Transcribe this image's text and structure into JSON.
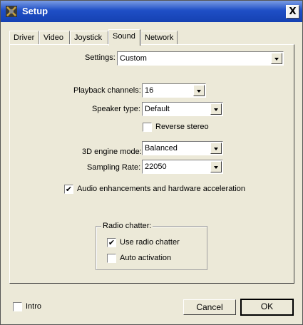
{
  "window": {
    "title": "Setup",
    "close_label": "X"
  },
  "tabs": [
    {
      "label": "Driver"
    },
    {
      "label": "Video"
    },
    {
      "label": "Joystick"
    },
    {
      "label": "Sound",
      "active": true
    },
    {
      "label": "Network"
    }
  ],
  "sound": {
    "settings_label": "Settings:",
    "settings_value": "Custom",
    "playback_channels_label": "Playback channels:",
    "playback_channels_value": "16",
    "speaker_type_label": "Speaker type:",
    "speaker_type_value": "Default",
    "reverse_stereo_label": "Reverse stereo",
    "reverse_stereo_checked": false,
    "engine_mode_label": "3D engine mode:",
    "engine_mode_value": "Balanced",
    "sampling_rate_label": "Sampling Rate:",
    "sampling_rate_value": "22050",
    "audio_enh_label": "Audio enhancements and hardware acceleration",
    "audio_enh_checked": true,
    "radio_group_label": "Radio chatter:",
    "use_radio_label": "Use radio chatter",
    "use_radio_checked": true,
    "auto_activation_label": "Auto activation",
    "auto_activation_checked": false
  },
  "footer": {
    "intro_label": "Intro",
    "intro_checked": false,
    "cancel_label": "Cancel",
    "ok_label": "OK"
  },
  "icons": {
    "app": "joystick-icon",
    "check_mark": "✔"
  }
}
